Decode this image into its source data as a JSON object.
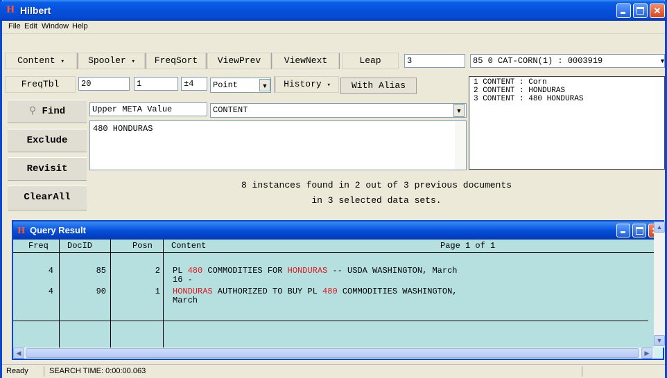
{
  "window": {
    "title": "Hilbert",
    "logo": "H"
  },
  "menu": {
    "items": [
      "File",
      "Edit",
      "Window",
      "Help"
    ]
  },
  "toolbar1": {
    "content": "Content",
    "spooler": "Spooler",
    "freqsort": "FreqSort",
    "viewprev": "ViewPrev",
    "viewnext": "ViewNext",
    "leap": "Leap",
    "leap_value": "3",
    "doc_select": "85 0 CAT-CORN(1) : 0003919"
  },
  "toolbar2": {
    "freqtbl": "FreqTbl",
    "freqtbl_value": "20",
    "field2": "1",
    "pm_symbol": "±",
    "pm_value": "4",
    "point": "Point",
    "history": "History",
    "with_alias": "With Alias"
  },
  "history_list": [
    "1 CONTENT : Corn",
    "2 CONTENT : HONDURAS",
    "3 CONTENT : 480 HONDURAS"
  ],
  "commands": {
    "find": "Find",
    "exclude": "Exclude",
    "revisit": "Revisit",
    "clearall": "ClearAll"
  },
  "meta": {
    "label": "Upper META Value",
    "field": "CONTENT"
  },
  "query_text": "480 HONDURAS",
  "summary": {
    "line1": "8 instances found in 2 out of 3 previous documents",
    "line2": "in 3 selected data sets."
  },
  "query_result": {
    "title": "Query Result",
    "logo": "H",
    "headers": {
      "freq": "Freq",
      "docid": "DocID",
      "posn": "Posn",
      "content": "Content",
      "page": "Page 1 of 1"
    },
    "rows": [
      {
        "freq": "4",
        "docid": "85",
        "posn": "2",
        "line1": [
          {
            "text": "PL ",
            "hl": false
          },
          {
            "text": "480",
            "hl": true
          },
          {
            "text": " COMMODITIES FOR ",
            "hl": false
          },
          {
            "text": "HONDURAS",
            "hl": true
          },
          {
            "text": " -- USDA WASHINGTON, March",
            "hl": false
          }
        ],
        "line2": "16 -"
      },
      {
        "freq": "4",
        "docid": "90",
        "posn": "1",
        "line1": [
          {
            "text": "HONDURAS",
            "hl": true
          },
          {
            "text": " AUTHORIZED TO BUY PL ",
            "hl": false
          },
          {
            "text": "480",
            "hl": true
          },
          {
            "text": " COMMODITIES WASHINGTON,",
            "hl": false
          }
        ],
        "line2": "March"
      }
    ]
  },
  "status": {
    "ready": "Ready",
    "search_time": "SEARCH TIME: 0:00:00.063"
  },
  "colors": {
    "highlight": "#e0181e",
    "result_bg": "#b6e0e0",
    "title_blue": "#0650dc"
  }
}
